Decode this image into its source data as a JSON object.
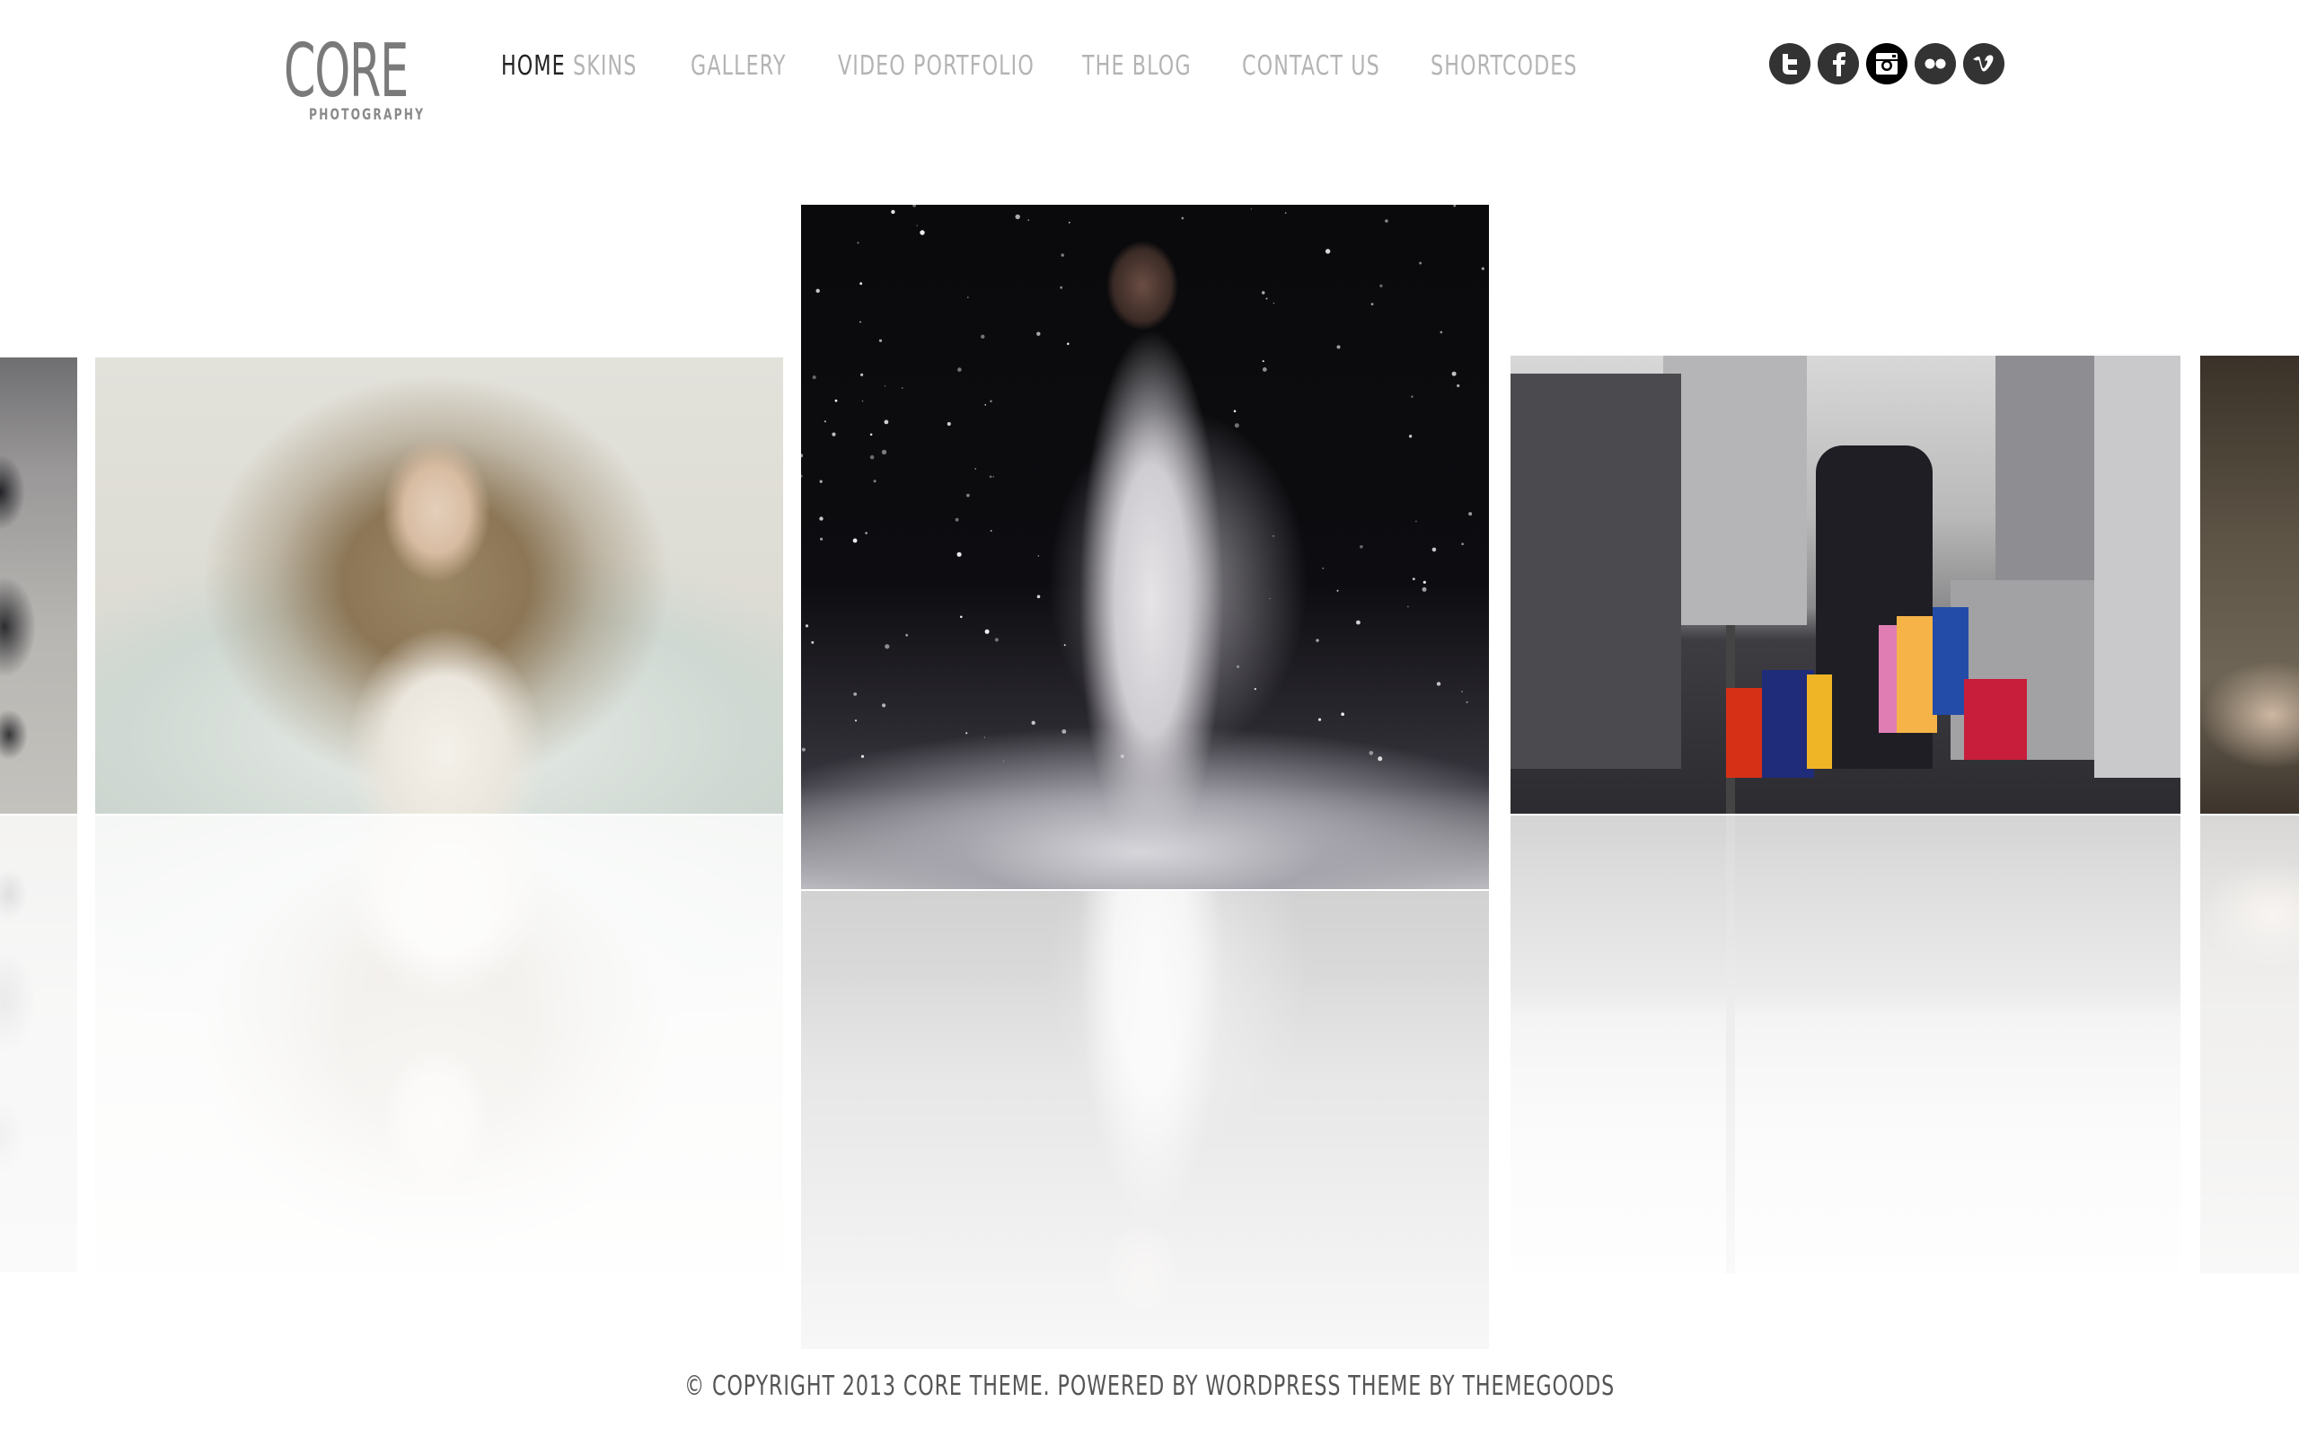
{
  "header": {
    "logo": {
      "title": "CORE",
      "subtitle": "PHOTOGRAPHY"
    },
    "nav": [
      {
        "label": "HOME",
        "active": true
      },
      {
        "label": "SKINS",
        "active": false
      },
      {
        "label": "GALLERY",
        "active": false
      },
      {
        "label": "VIDEO PORTFOLIO",
        "active": false
      },
      {
        "label": "THE BLOG",
        "active": false
      },
      {
        "label": "CONTACT US",
        "active": false
      },
      {
        "label": "SHORTCODES",
        "active": false
      }
    ],
    "social": [
      {
        "name": "twitter",
        "icon": "twitter-icon"
      },
      {
        "name": "facebook",
        "icon": "facebook-icon"
      },
      {
        "name": "instagram",
        "icon": "instagram-icon",
        "active": true
      },
      {
        "name": "flickr",
        "icon": "flickr-icon"
      },
      {
        "name": "vimeo",
        "icon": "vimeo-icon"
      }
    ]
  },
  "gallery": {
    "slides": [
      {
        "name": "abstract-tree-photo",
        "description": "grey abstract ink tree (partially visible)"
      },
      {
        "name": "woman-on-bed-photo",
        "description": "woman with long wavy hair lying on white bed"
      },
      {
        "name": "woman-in-space-photo",
        "description": "woman in white gown among stars",
        "active": true
      },
      {
        "name": "city-shopping-photo",
        "description": "woman with shopping bags on city street"
      },
      {
        "name": "interior-heels-photo",
        "description": "interior with high heels (partially visible)"
      }
    ],
    "reflection": true
  },
  "colors": {
    "nav_active": "#222222",
    "nav_inactive": "#b4b4b4",
    "logo": "#7a7a7a",
    "footer_text": "#555555",
    "social_bg": "#333333",
    "social_active_bg": "#000000"
  },
  "footer": {
    "text": "© COPYRIGHT 2013 CORE THEME. POWERED BY WORDPRESS THEME BY THEMEGOODS"
  }
}
